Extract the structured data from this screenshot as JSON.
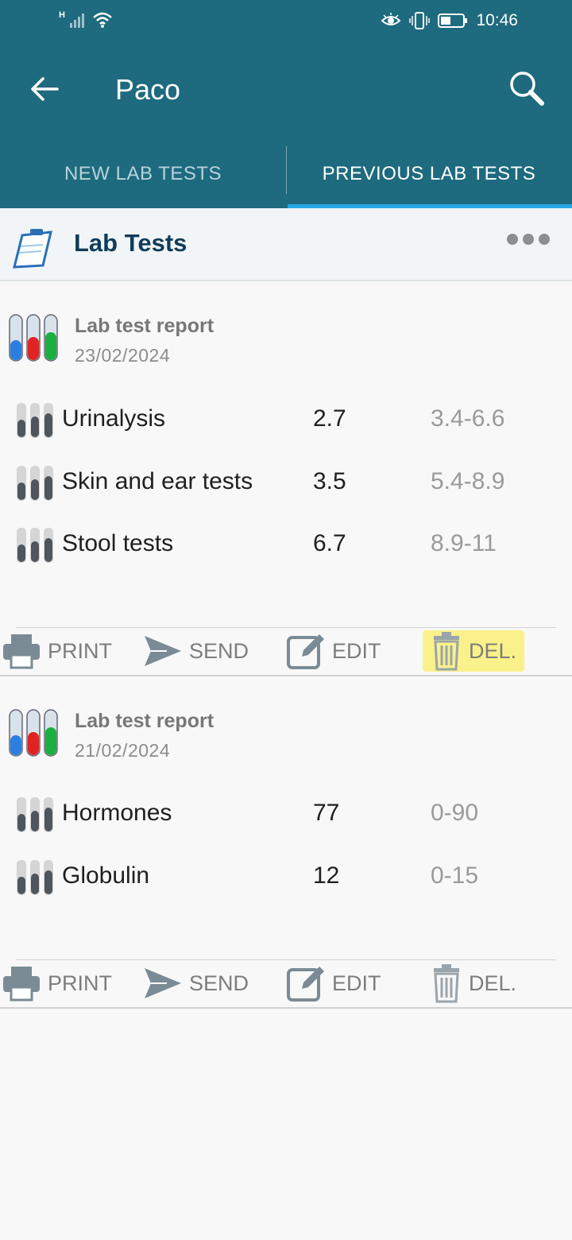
{
  "status_bar": {
    "time": "10:46",
    "network": "H"
  },
  "app_bar": {
    "title": "Paco"
  },
  "tabs": [
    {
      "label": "NEW LAB TESTS"
    },
    {
      "label": "PREVIOUS LAB TESTS"
    }
  ],
  "section": {
    "title": "Lab Tests"
  },
  "reports": [
    {
      "title": "Lab test report",
      "date": "23/02/2024",
      "tests": [
        {
          "name": "Urinalysis",
          "value": "2.7",
          "range": "3.4-6.6"
        },
        {
          "name": "Skin and ear tests",
          "value": "3.5",
          "range": "5.4-8.9"
        },
        {
          "name": "Stool tests",
          "value": "6.7",
          "range": "8.9-11"
        }
      ],
      "actions": {
        "print": "PRINT",
        "send": "SEND",
        "edit": "EDIT",
        "delete": "DEL."
      }
    },
    {
      "title": "Lab test report",
      "date": "21/02/2024",
      "tests": [
        {
          "name": "Hormones",
          "value": "77",
          "range": "0-90"
        },
        {
          "name": "Globulin",
          "value": "12",
          "range": "0-15"
        }
      ],
      "actions": {
        "print": "PRINT",
        "send": "SEND",
        "edit": "EDIT",
        "delete": "DEL."
      }
    }
  ],
  "colors": {
    "primary": "#1e6a7e",
    "tab_indicator": "#27a9e8",
    "highlight": "#fbf18a"
  }
}
